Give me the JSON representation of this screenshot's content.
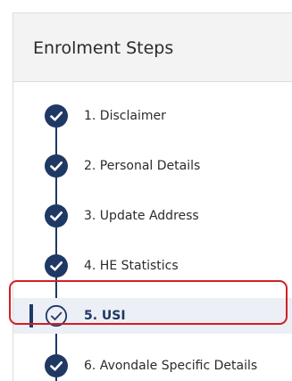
{
  "panel": {
    "title": "Enrolment Steps"
  },
  "steps": [
    {
      "label": "1. Disclaimer",
      "status": "complete",
      "icon": "check-circle-icon"
    },
    {
      "label": "2. Personal Details",
      "status": "complete",
      "icon": "check-circle-icon"
    },
    {
      "label": "3. Update Address",
      "status": "complete",
      "icon": "check-circle-icon"
    },
    {
      "label": "4. HE Statistics",
      "status": "complete",
      "icon": "check-circle-icon"
    },
    {
      "label": "5. USI",
      "status": "current",
      "icon": "check-circle-outline-icon"
    },
    {
      "label": "6. Avondale Specific Details",
      "status": "complete",
      "icon": "check-circle-icon"
    }
  ],
  "colors": {
    "accent": "#1f3864",
    "highlight": "#d11f26",
    "active_bg": "#eceff6",
    "header_bg": "#f3f3f3"
  }
}
